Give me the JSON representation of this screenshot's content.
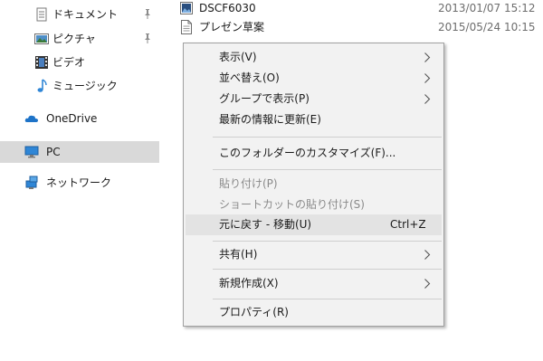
{
  "nav": {
    "items": [
      {
        "label": "ドキュメント",
        "icon": "documents-icon",
        "pinned": true
      },
      {
        "label": "ピクチャ",
        "icon": "pictures-icon",
        "pinned": true
      },
      {
        "label": "ビデオ",
        "icon": "videos-icon",
        "pinned": false
      },
      {
        "label": "ミュージック",
        "icon": "music-icon",
        "pinned": false
      },
      {
        "label": "OneDrive",
        "icon": "onedrive-icon",
        "pinned": false
      },
      {
        "label": "PC",
        "icon": "pc-icon",
        "pinned": false,
        "selected": true
      },
      {
        "label": "ネットワーク",
        "icon": "network-icon",
        "pinned": false
      }
    ]
  },
  "files": [
    {
      "name": "DSCF6030",
      "date": "2013/01/07 15:12",
      "icon": "image-file-icon"
    },
    {
      "name": "プレゼン草案",
      "date": "2015/05/24 10:15",
      "icon": "text-file-icon"
    }
  ],
  "context_menu": {
    "items": [
      {
        "label": "表示(V)",
        "submenu": true
      },
      {
        "label": "並べ替え(O)",
        "submenu": true
      },
      {
        "label": "グループで表示(P)",
        "submenu": true
      },
      {
        "label": "最新の情報に更新(E)"
      },
      {
        "label": "このフォルダーのカスタマイズ(F)..."
      },
      {
        "label": "貼り付け(P)",
        "disabled": true
      },
      {
        "label": "ショートカットの貼り付け(S)",
        "disabled": true
      },
      {
        "label": "元に戻す - 移動(U)",
        "shortcut": "Ctrl+Z",
        "highlighted": true
      },
      {
        "label": "共有(H)",
        "submenu": true
      },
      {
        "label": "新規作成(X)",
        "submenu": true
      },
      {
        "label": "プロパティ(R)"
      }
    ]
  },
  "colors": {
    "nav_selected": "#d9d9d9",
    "menu_background": "#f2f2f2",
    "menu_highlight": "#e3e3e3",
    "disabled_text": "#8a8a8a",
    "onedrive_blue": "#1e73c8"
  }
}
